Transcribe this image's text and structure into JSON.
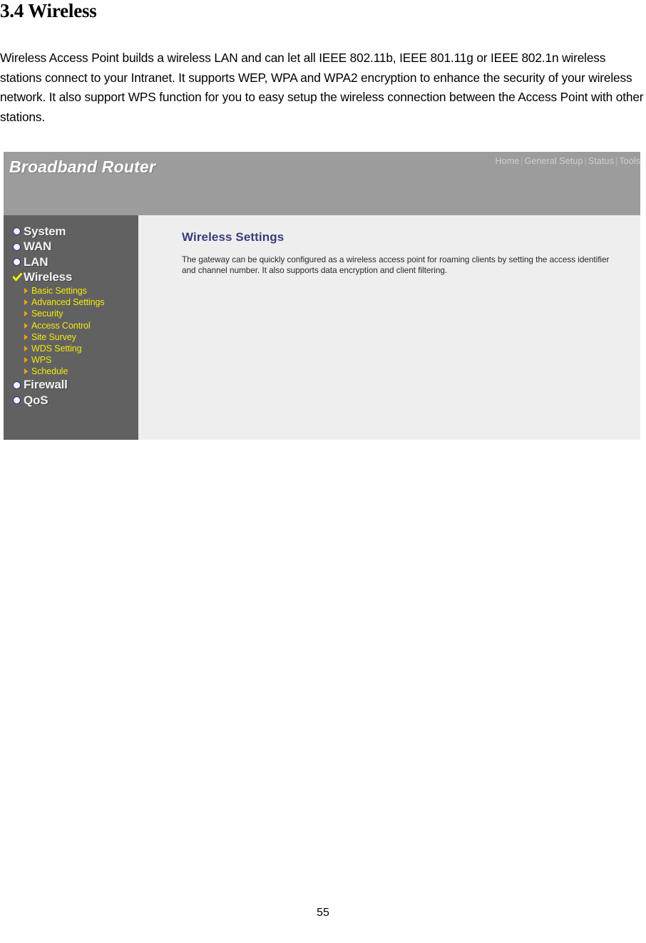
{
  "document": {
    "heading": "3.4 Wireless",
    "paragraph": "Wireless Access Point builds a wireless LAN and can let all IEEE 802.11b, IEEE 801.11g or IEEE 802.1n wireless stations connect to your Intranet. It supports WEP, WPA and WPA2 encryption to enhance the security of your wireless network. It also support WPS function for you to easy setup the wireless connection between the Access Point with other stations.",
    "page_number": "55"
  },
  "router_ui": {
    "header": {
      "logo": "Broadband Router",
      "nav_links": [
        "Home",
        "General Setup",
        "Status",
        "Tools"
      ],
      "separator": "|"
    },
    "sidebar": {
      "items": [
        {
          "label": "System",
          "icon": "bullet-icon",
          "selected": false
        },
        {
          "label": "WAN",
          "icon": "bullet-icon",
          "selected": false
        },
        {
          "label": "LAN",
          "icon": "bullet-icon",
          "selected": false
        },
        {
          "label": "Wireless",
          "icon": "check-icon",
          "selected": true
        }
      ],
      "sub_items": [
        {
          "label": "Basic Settings",
          "icon": "arrow-icon"
        },
        {
          "label": "Advanced Settings",
          "icon": "arrow-icon"
        },
        {
          "label": "Security",
          "icon": "arrow-icon"
        },
        {
          "label": "Access Control",
          "icon": "arrow-icon"
        },
        {
          "label": "Site Survey",
          "icon": "arrow-icon"
        },
        {
          "label": "WDS Setting",
          "icon": "arrow-icon"
        },
        {
          "label": "WPS",
          "icon": "arrow-icon"
        },
        {
          "label": "Schedule",
          "icon": "arrow-icon"
        }
      ],
      "items_after": [
        {
          "label": "Firewall",
          "icon": "bullet-icon",
          "selected": false
        },
        {
          "label": "QoS",
          "icon": "bullet-icon",
          "selected": false
        }
      ]
    },
    "main": {
      "title": "Wireless Settings",
      "description": "The gateway can be quickly configured as a wireless access point for roaming clients by setting the access identifier and channel number. It also supports data encryption and client filtering."
    },
    "colors": {
      "header_bg": "#9c9c9c",
      "sidebar_bg": "#616161",
      "content_bg": "#eeeeee",
      "title_color": "#3b3b7d",
      "sub_item_color": "#f2e80c",
      "arrow_color": "#f0a500"
    }
  }
}
